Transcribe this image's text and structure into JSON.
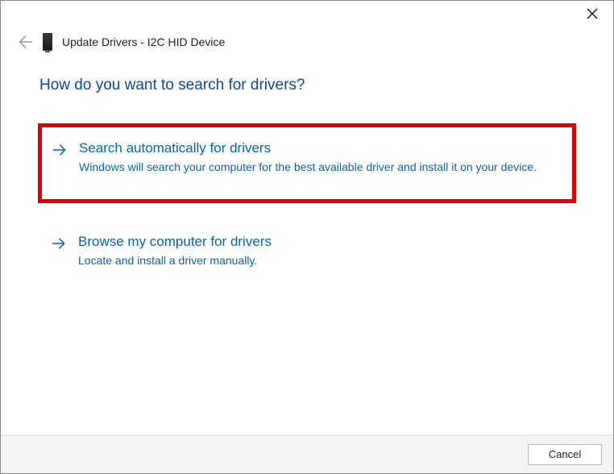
{
  "window": {
    "title": "Update Drivers - I2C HID Device"
  },
  "heading": "How do you want to search for drivers?",
  "options": [
    {
      "title": "Search automatically for drivers",
      "description": "Windows will search your computer for the best available driver and install it on your device."
    },
    {
      "title": "Browse my computer for drivers",
      "description": "Locate and install a driver manually."
    }
  ],
  "footer": {
    "cancel_label": "Cancel"
  }
}
